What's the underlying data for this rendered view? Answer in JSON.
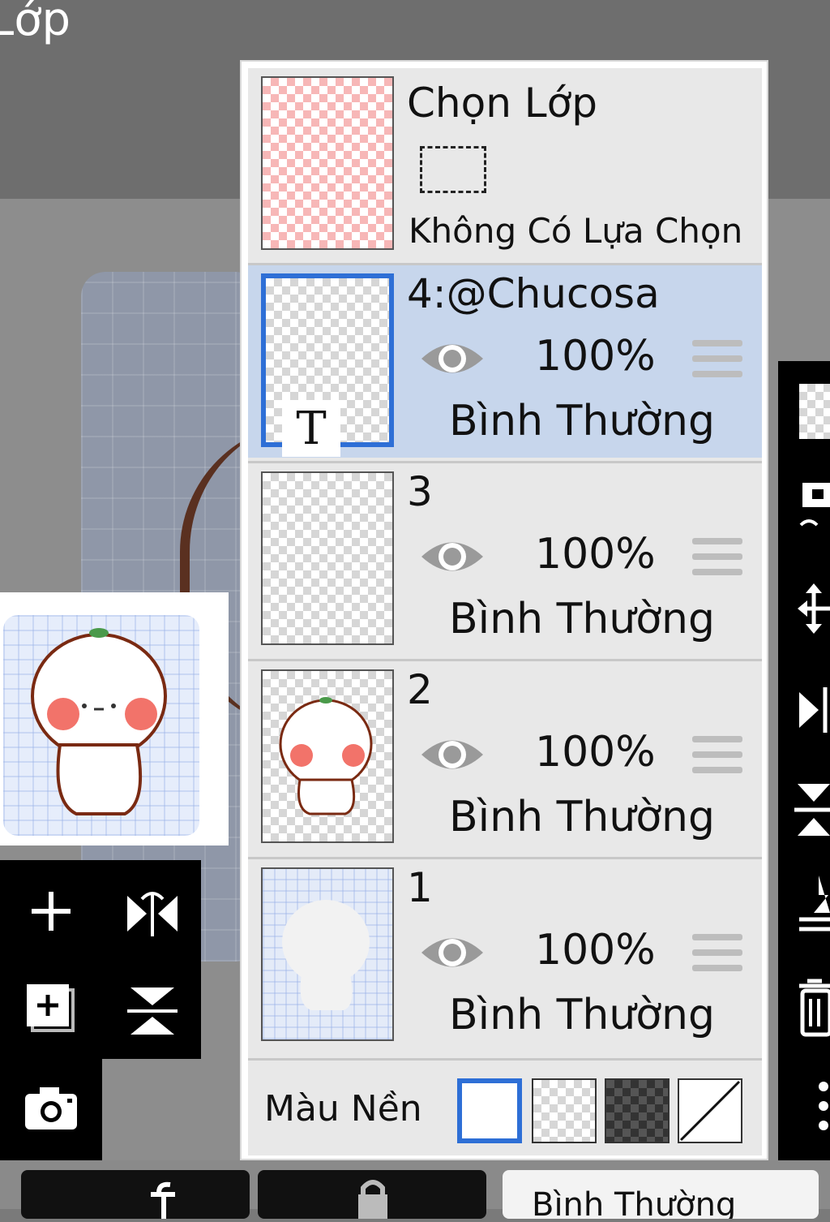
{
  "screen": {
    "title": "Lớp"
  },
  "selection": {
    "title": "Chọn Lớp",
    "status": "Không Có Lựa Chọn"
  },
  "layers": [
    {
      "name": "4:@Chucosa",
      "opacity": "100%",
      "blend": "Bình Thường",
      "selected": true,
      "type_badge": "T"
    },
    {
      "name": "3",
      "opacity": "100%",
      "blend": "Bình Thường",
      "selected": false
    },
    {
      "name": "2",
      "opacity": "100%",
      "blend": "Bình Thường",
      "selected": false
    },
    {
      "name": "1",
      "opacity": "100%",
      "blend": "Bình Thường",
      "selected": false
    }
  ],
  "background": {
    "label": "Màu Nền",
    "options": [
      "white",
      "transparent",
      "dark-checker",
      "none"
    ],
    "selected": "white"
  },
  "bottom_bar": {
    "blend_mode": "Bình Thường"
  },
  "colors": {
    "accent": "#2e6fd6",
    "selected_row": "#c7d6ec",
    "panel": "#e8e8e8"
  }
}
